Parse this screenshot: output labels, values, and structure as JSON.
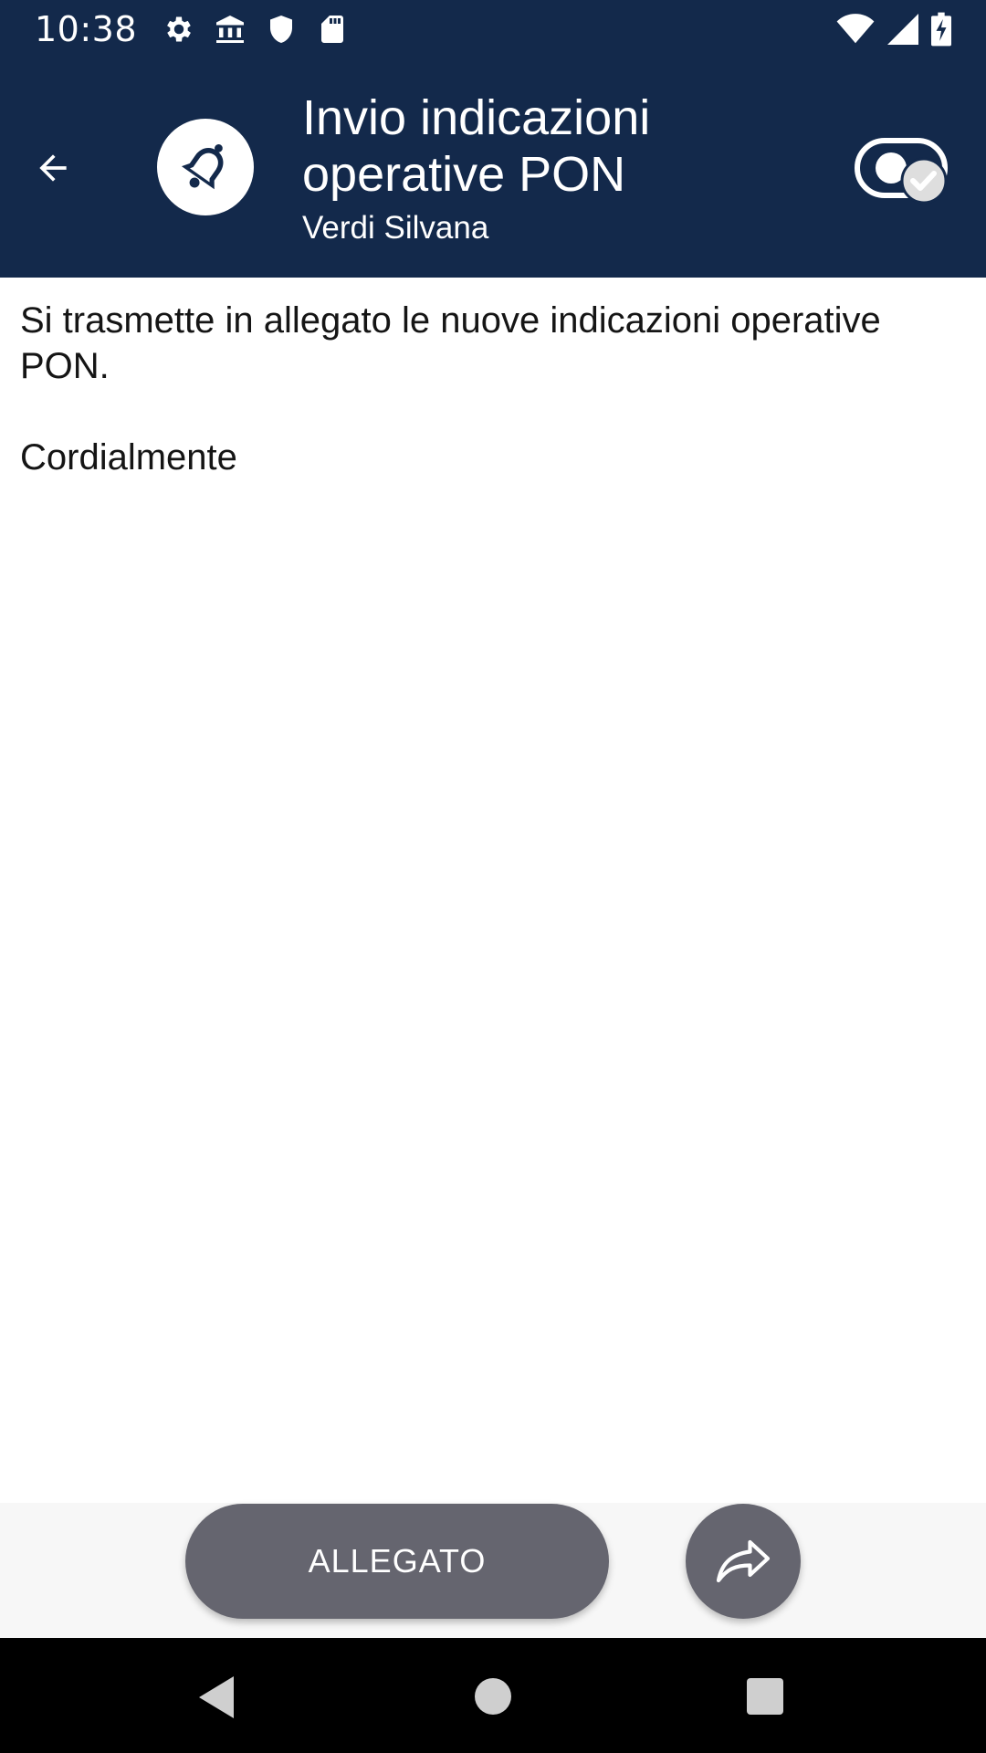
{
  "status_bar": {
    "time": "10:38",
    "left_icons": [
      "gear-icon",
      "bank-icon",
      "shield-icon",
      "sd-card-icon"
    ],
    "right_icons": [
      "wifi-icon",
      "signal-icon",
      "battery-charging-icon"
    ]
  },
  "header": {
    "title": "Invio indicazioni operative PON",
    "subtitle": "Verdi Silvana",
    "avatar_icon": "bell-icon",
    "toggle_icon": "read-toggle-icon",
    "colors": {
      "background": "#13294b",
      "text": "#ffffff"
    }
  },
  "message": {
    "body": "Si trasmette in allegato le nuove indicazioni operative PON.\n\nCordialmente"
  },
  "actions": {
    "attachment_label": "ALLEGATO",
    "share_icon": "share-icon",
    "button_color": "#65656f"
  },
  "nav_bar": {
    "icons": [
      "nav-back-icon",
      "nav-home-icon",
      "nav-recents-icon"
    ]
  }
}
